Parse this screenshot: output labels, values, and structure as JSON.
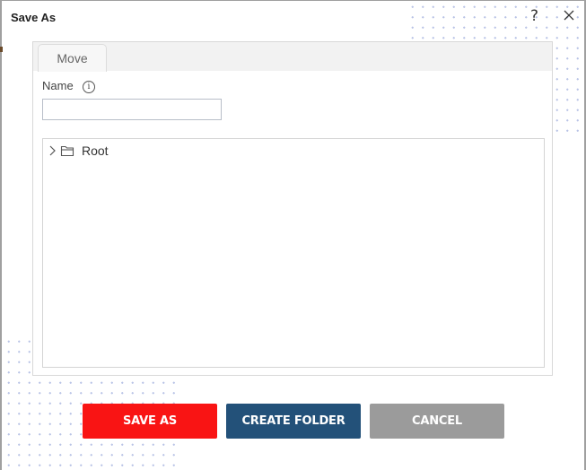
{
  "dialog": {
    "title": "Save As",
    "help_icon": "?",
    "close_icon": "close-icon"
  },
  "tabs": [
    {
      "label": "Move",
      "active": true
    }
  ],
  "form": {
    "name_label": "Name",
    "info_icon": "i",
    "name_value": "",
    "name_placeholder": ""
  },
  "tree": {
    "items": [
      {
        "label": "Root",
        "expanded": false,
        "icon": "folder-icon"
      }
    ]
  },
  "buttons": {
    "save_as": "SAVE AS",
    "create_folder": "CREATE FOLDER",
    "cancel": "CANCEL"
  },
  "colors": {
    "save_as": "#f91414",
    "create_folder": "#235179",
    "cancel": "#9b9b9b"
  }
}
